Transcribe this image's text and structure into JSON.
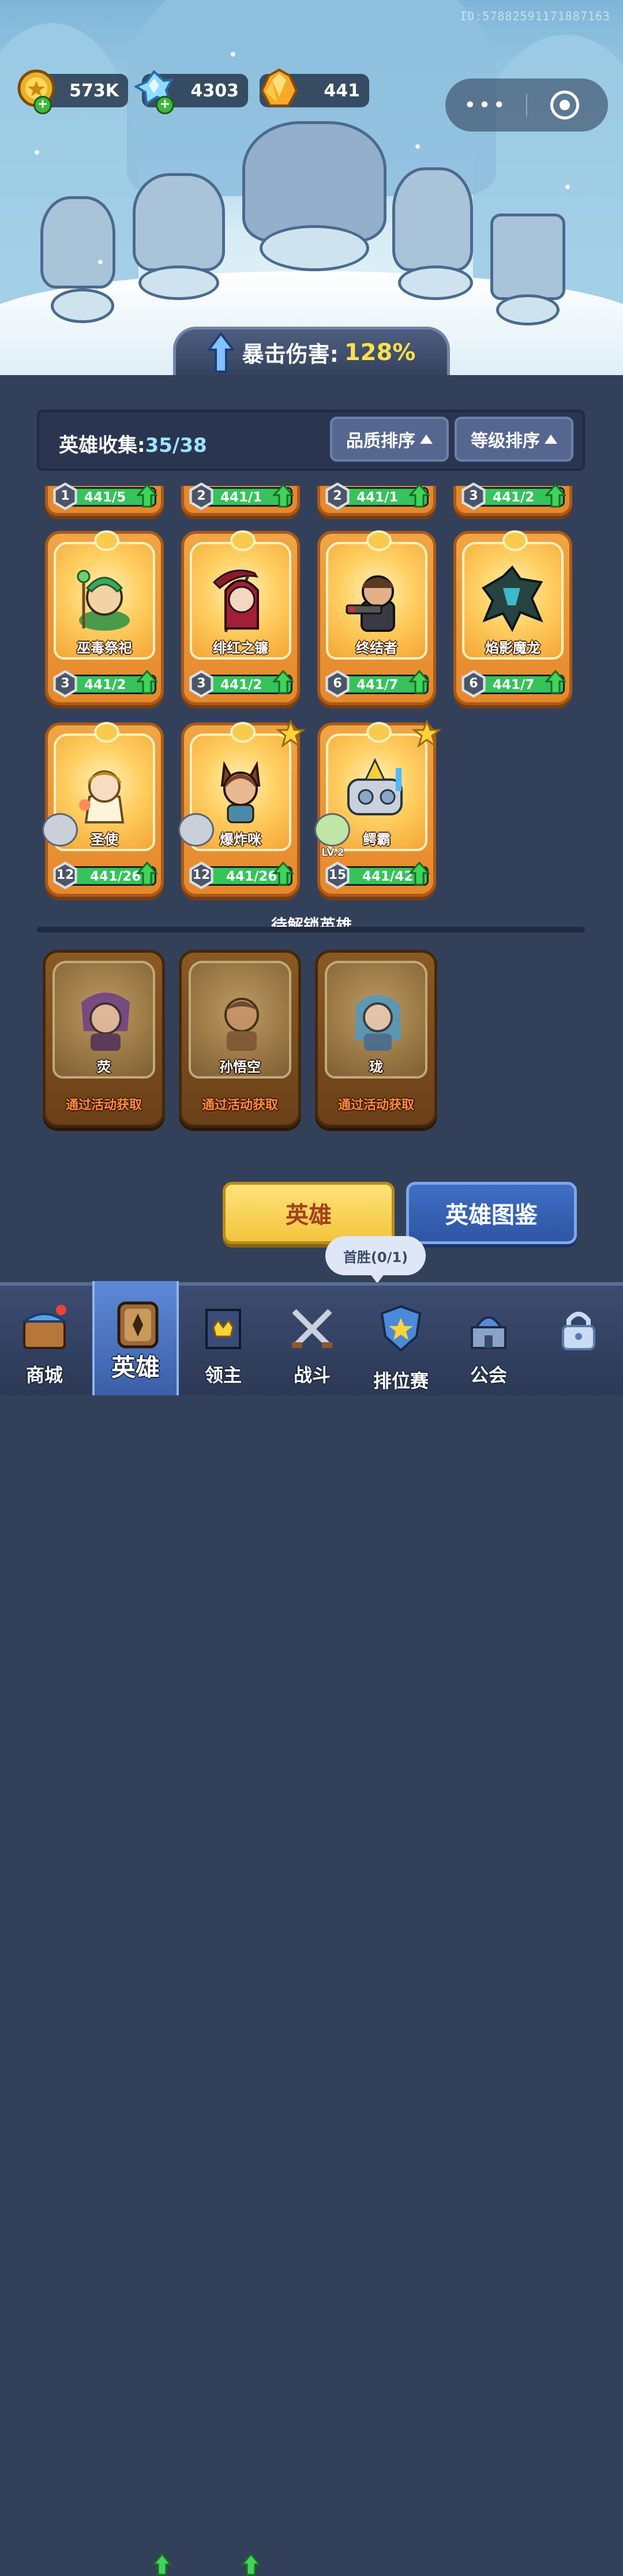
{
  "top": {
    "player_id": "ID:57882591171887163",
    "resources": [
      {
        "icon": "gold-coin-icon",
        "value": "573K"
      },
      {
        "icon": "blue-crystal-icon",
        "value": "4303"
      },
      {
        "icon": "orange-gem-icon",
        "value": "441"
      }
    ],
    "capsule": {
      "more_icon": "more-dots-icon",
      "close_icon": "target-circle-icon"
    }
  },
  "crit": {
    "label": "暴击伤害:",
    "value": "128%"
  },
  "collection": {
    "title": "英雄收集:",
    "count": "35/38",
    "sort_quality": "品质排序",
    "sort_level": "等级排序"
  },
  "peek_row": [
    {
      "level": "1",
      "progress_text": "441/5",
      "fill": 1
    },
    {
      "level": "2",
      "progress_text": "441/1",
      "fill": 1
    },
    {
      "level": "2",
      "progress_text": "441/1",
      "fill": 1
    },
    {
      "level": "3",
      "progress_text": "441/2",
      "fill": 1
    }
  ],
  "heroes_row1": [
    {
      "name": "巫毒祭祀",
      "level": "3",
      "progress_text": "441/2",
      "fill": 1
    },
    {
      "name": "绯红之镰",
      "level": "3",
      "progress_text": "441/2",
      "fill": 1
    },
    {
      "name": "终结者",
      "level": "6",
      "progress_text": "441/7",
      "fill": 1
    },
    {
      "name": "焰影魔龙",
      "level": "6",
      "progress_text": "441/7",
      "fill": 1
    }
  ],
  "heroes_row2": [
    {
      "name": "圣使",
      "level": "12",
      "progress_text": "441/26",
      "fill": 1
    },
    {
      "name": "爆炸咪",
      "level": "12",
      "progress_text": "441/26",
      "fill": 1
    },
    {
      "name": "鳄霸",
      "level": "15",
      "progress_text": "441/42",
      "fill": 1,
      "pet_level": "LV.2"
    }
  ],
  "locked_section_title": "待解锁英雄",
  "locked_heroes": [
    {
      "name": "荧",
      "how": "通过活动获取"
    },
    {
      "name": "孙悟空",
      "how": "通过活动获取"
    },
    {
      "name": "珑",
      "how": "通过活动获取"
    }
  ],
  "tabs": {
    "heroes": "英雄",
    "codex": "英雄图鉴"
  },
  "tooltip": "首胜(0/1)",
  "nav": [
    {
      "label": "商城",
      "icon": "shop-chest-icon"
    },
    {
      "label": "英雄",
      "icon": "hero-card-icon"
    },
    {
      "label": "领主",
      "icon": "lord-banner-icon"
    },
    {
      "label": "战斗",
      "icon": "crossed-swords-icon"
    },
    {
      "label": "排位赛",
      "icon": "ranked-emblem-icon"
    },
    {
      "label": "公会",
      "icon": "guild-castle-icon"
    },
    {
      "label": "",
      "icon": "lock-icon"
    }
  ],
  "colors": {
    "accent_green": "#36c35a",
    "card_orange": "#e6882b",
    "crit_yellow": "#ffe04a"
  }
}
